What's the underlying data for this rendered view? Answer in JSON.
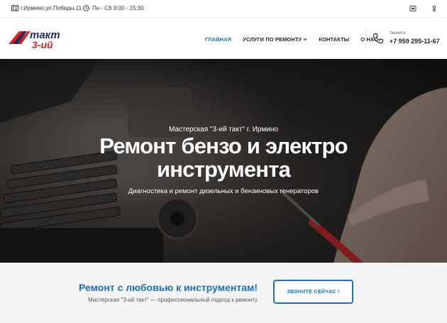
{
  "topbar": {
    "address": "г.Ирмино,ул.Победы,11",
    "hours": "Пн - Сб 9:00 - 15:30",
    "address_icon": "map-icon",
    "hours_icon": "clock-icon",
    "social_icons": [
      "vk-icon",
      "odnoklassniki-icon"
    ]
  },
  "header": {
    "logo": {
      "top": "такт",
      "bottom": "3-ий"
    },
    "nav": [
      {
        "label": "ГЛАВНАЯ",
        "active": true
      },
      {
        "label": "УСЛУГИ ПО РЕМОНТУ",
        "dropdown": true
      },
      {
        "label": "КОНТАКТЫ"
      },
      {
        "label": "О НАС"
      }
    ],
    "phone_caption": "Звоните",
    "phone_number": "+7 959 295-11-67",
    "phone_icon": "phone-icon"
  },
  "hero": {
    "eyebrow": "Мастерская \"3-ий такт\" г. Ирмино",
    "title_line1": "Ремонт бензо и электро",
    "title_line2": "инструмента",
    "subtitle": "Диагностика и ремонт дизельных и бензиновых генераторов"
  },
  "cta": {
    "heading": "Ремонт с любовью к инструментам!",
    "text": "Мастерская \"3-ий такт\" — профессиональный подход к ремонту",
    "button": "ЗВОНИТЕ СЕЙЧАС !"
  },
  "colors": {
    "accent": "#1d6fb8",
    "logo_red": "#d42027",
    "logo_navy": "#1e2a5a"
  }
}
